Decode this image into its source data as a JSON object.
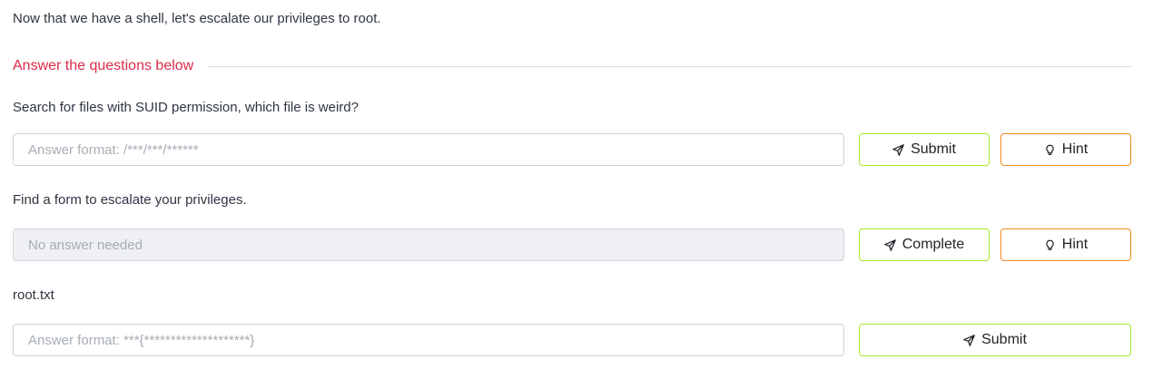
{
  "intro_text": "Now that we have a shell, let's escalate our privileges to root.",
  "section": {
    "title": "Answer the questions below"
  },
  "questions": [
    {
      "text": "Search for files with SUID permission, which file is weird?",
      "placeholder": "Answer format: /***/***/******",
      "value": "",
      "submit_label": "Submit",
      "hint_label": "Hint"
    },
    {
      "text": "Find a form to escalate your privileges.",
      "placeholder": "No answer needed",
      "value": "",
      "submit_label": "Complete",
      "hint_label": "Hint"
    },
    {
      "text": "root.txt",
      "placeholder": "Answer format: ***{********************}",
      "value": "",
      "submit_label": "Submit"
    }
  ],
  "colors": {
    "heading": "#dc2a4a",
    "submit_border": "#a3ea2a",
    "hint_border": "#ef8a1f"
  },
  "icons": {
    "submit": "paper-plane-icon",
    "hint": "lightbulb-icon"
  }
}
